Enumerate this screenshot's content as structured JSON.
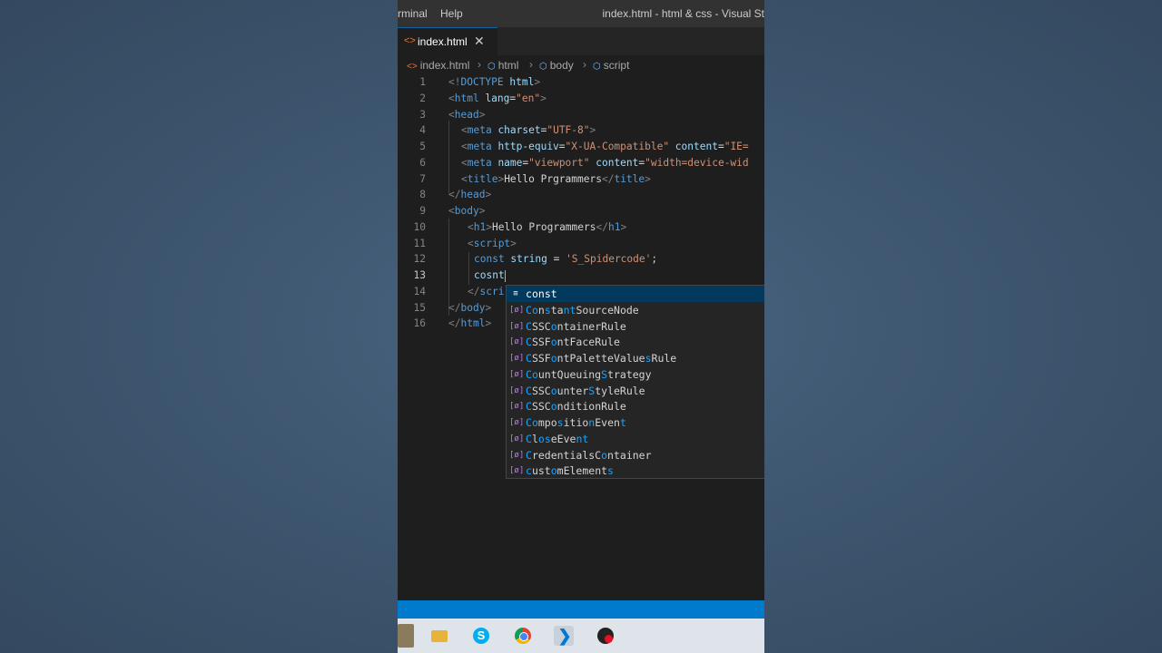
{
  "titlebar": {
    "menu": [
      "rminal",
      "Help"
    ],
    "window_title": "index.html - html & css - Visual St"
  },
  "tab": {
    "label": "index.html",
    "close": "✕"
  },
  "breadcrumb": [
    "index.html",
    "html",
    "body",
    "script"
  ],
  "editor": {
    "line_numbers": [
      "1",
      "2",
      "3",
      "4",
      "5",
      "6",
      "7",
      "8",
      "9",
      "10",
      "11",
      "12",
      "13",
      "14",
      "15",
      "16"
    ],
    "active_line": "13",
    "lines": {
      "l1": [
        "<!",
        "DOCTYPE",
        " html",
        ">"
      ],
      "l2": [
        "<",
        "html",
        " lang",
        "=",
        "\"en\"",
        ">"
      ],
      "l3": [
        "<",
        "head",
        ">"
      ],
      "l4": [
        "<",
        "meta",
        " charset",
        "=",
        "\"UTF-8\"",
        ">"
      ],
      "l5": [
        "<",
        "meta",
        " http-equiv",
        "=",
        "\"X-UA-Compatible\"",
        " content",
        "=",
        "\"IE="
      ],
      "l6": [
        "<",
        "meta",
        " name",
        "=",
        "\"viewport\"",
        " content",
        "=",
        "\"width=device-wid"
      ],
      "l7": [
        "<",
        "title",
        ">",
        "Hello Prgrammers",
        "</",
        "title",
        ">"
      ],
      "l8": [
        "</",
        "head",
        ">"
      ],
      "l9": [
        "<",
        "body",
        ">"
      ],
      "l10": [
        "<",
        "h1",
        ">",
        "Hello Programmers",
        "</",
        "h1",
        ">"
      ],
      "l11": [
        "<",
        "script",
        ">"
      ],
      "l12": [
        "const",
        " string",
        " = ",
        "'S_Spidercode'",
        ";"
      ],
      "l13": [
        "cosnt"
      ],
      "l14": [
        "</",
        "scri"
      ],
      "l15": [
        "</",
        "body",
        ">"
      ],
      "l16": [
        "</",
        "html",
        ">"
      ]
    }
  },
  "suggestions": [
    {
      "icon": "keyword-icon",
      "glyph": "≡",
      "label": "const"
    },
    {
      "icon": "variable-icon",
      "glyph": "[ø]",
      "label": "ConstantSourceNode"
    },
    {
      "icon": "variable-icon",
      "glyph": "[ø]",
      "label": "CSSContainerRule"
    },
    {
      "icon": "variable-icon",
      "glyph": "[ø]",
      "label": "CSSFontFaceRule"
    },
    {
      "icon": "variable-icon",
      "glyph": "[ø]",
      "label": "CSSFontPaletteValuesRule"
    },
    {
      "icon": "variable-icon",
      "glyph": "[ø]",
      "label": "CountQueuingStrategy"
    },
    {
      "icon": "variable-icon",
      "glyph": "[ø]",
      "label": "CSSCounterStyleRule"
    },
    {
      "icon": "variable-icon",
      "glyph": "[ø]",
      "label": "CSSConditionRule"
    },
    {
      "icon": "variable-icon",
      "glyph": "[ø]",
      "label": "CompositionEvent"
    },
    {
      "icon": "variable-icon",
      "glyph": "[ø]",
      "label": "CloseEvent"
    },
    {
      "icon": "variable-icon",
      "glyph": "[ø]",
      "label": "CredentialsContainer"
    },
    {
      "icon": "variable-icon",
      "glyph": "[ø]",
      "label": "customElements"
    }
  ],
  "taskbar": [
    "start-icon",
    "file-explorer-icon",
    "skype-icon",
    "chrome-icon",
    "vscode-icon",
    "recorder-icon"
  ],
  "colors": {
    "accent": "#007acc",
    "background": "#1e1e1e",
    "selection": "#04395e"
  }
}
